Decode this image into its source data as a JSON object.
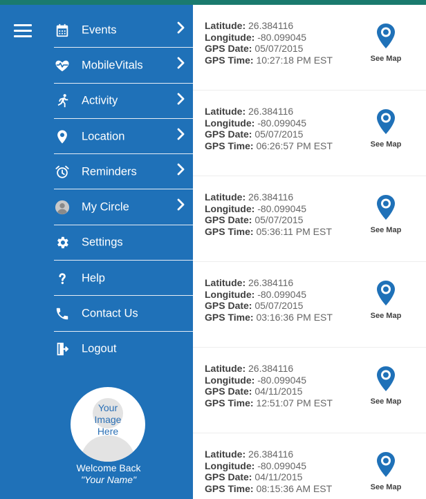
{
  "menu": {
    "items": [
      {
        "label": "Events",
        "icon": "calendar-icon",
        "chevron": true
      },
      {
        "label": "MobileVitals",
        "icon": "heart-pulse-icon",
        "chevron": true
      },
      {
        "label": "Activity",
        "icon": "running-person-icon",
        "chevron": true
      },
      {
        "label": "Location",
        "icon": "location-pin-icon",
        "chevron": true
      },
      {
        "label": "Reminders",
        "icon": "alarm-clock-icon",
        "chevron": true
      },
      {
        "label": "My Circle",
        "icon": "person-icon",
        "chevron": true
      },
      {
        "label": "Settings",
        "icon": "gear-icon",
        "chevron": false
      },
      {
        "label": "Help",
        "icon": "question-mark-icon",
        "chevron": false
      },
      {
        "label": "Contact Us",
        "icon": "phone-icon",
        "chevron": false
      },
      {
        "label": "Logout",
        "icon": "logout-icon",
        "chevron": false
      }
    ]
  },
  "profile": {
    "avatar_text": [
      "Your",
      "Image",
      "Here"
    ],
    "welcome": "Welcome Back",
    "name": "\"Your Name\""
  },
  "labels": {
    "latitude": "Latitude:",
    "longitude": "Longitude:",
    "gps_date": "GPS Date:",
    "gps_time": "GPS Time:",
    "see_map": "See Map"
  },
  "records": [
    {
      "latitude": "26.384116",
      "longitude": "-80.099045",
      "date": "05/07/2015",
      "time": "10:27:18 PM EST"
    },
    {
      "latitude": "26.384116",
      "longitude": "-80.099045",
      "date": "05/07/2015",
      "time": "06:26:57 PM EST"
    },
    {
      "latitude": "26.384116",
      "longitude": "-80.099045",
      "date": "05/07/2015",
      "time": "05:36:11 PM EST"
    },
    {
      "latitude": "26.384116",
      "longitude": "-80.099045",
      "date": "05/07/2015",
      "time": "03:16:36 PM EST"
    },
    {
      "latitude": "26.384116",
      "longitude": "-80.099045",
      "date": "04/11/2015",
      "time": "12:51:07 PM EST"
    },
    {
      "latitude": "26.384116",
      "longitude": "-80.099045",
      "date": "04/11/2015",
      "time": "08:15:36 AM EST"
    }
  ],
  "colors": {
    "sidebar": "#1f71b8",
    "topbar": "#1a7a6e",
    "pin": "#1f71b8"
  }
}
